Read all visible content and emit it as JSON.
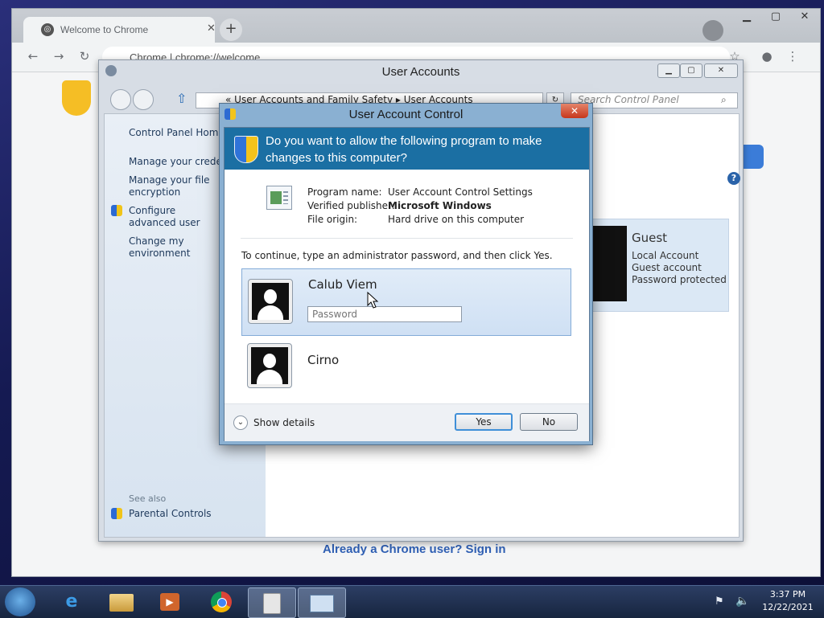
{
  "chrome": {
    "tab_title": "Welcome to Chrome",
    "url": "Chrome  |  chrome://welcome",
    "signin_link": "Already a Chrome user? Sign in"
  },
  "user_accounts": {
    "title": "User Accounts",
    "breadcrumb": "«  User Accounts and Family Safety  ▸  User Accounts",
    "search_placeholder": "Search Control Panel",
    "sidebar": [
      {
        "label": "Control Panel Home"
      },
      {
        "label": "Manage your credentials"
      },
      {
        "label": "Manage your file encryption certificates"
      },
      {
        "label": "Configure advanced user profile properties"
      },
      {
        "label": "Change my environment variables"
      }
    ],
    "see_also": "See also",
    "parental_controls": "Parental Controls",
    "guest": {
      "name": "Guest",
      "line1": "Local Account",
      "line2": "Guest account",
      "line3": "Password protected"
    }
  },
  "uac": {
    "title": "User Account Control",
    "question": "Do you want to allow the following program to make changes to this computer?",
    "program_label": "Program name:",
    "program_value": "User Account Control Settings",
    "publisher_label": "Verified publisher:",
    "publisher_value": "Microsoft Windows",
    "origin_label": "File origin:",
    "origin_value": "Hard drive on this computer",
    "continue_text": "To continue, type an administrator password, and then click Yes.",
    "users": [
      {
        "name": "Calub Viem",
        "password_placeholder": "Password",
        "password_value": ""
      },
      {
        "name": "Cirno"
      }
    ],
    "show_details": "Show details",
    "yes_label": "Yes",
    "no_label": "No"
  },
  "taskbar": {
    "time": "3:37 PM",
    "date": "12/22/2021",
    "items": [
      {
        "icon": "internet-explorer-icon"
      },
      {
        "icon": "file-explorer-icon"
      },
      {
        "icon": "media-player-icon"
      },
      {
        "icon": "chrome-icon"
      },
      {
        "icon": "secure-desktop-icon"
      },
      {
        "icon": "user-account-control-icon"
      }
    ]
  },
  "colors": {
    "uac_header": "#1b6fa3",
    "taskbar": "#1b2a47",
    "link": "#1e395b"
  }
}
